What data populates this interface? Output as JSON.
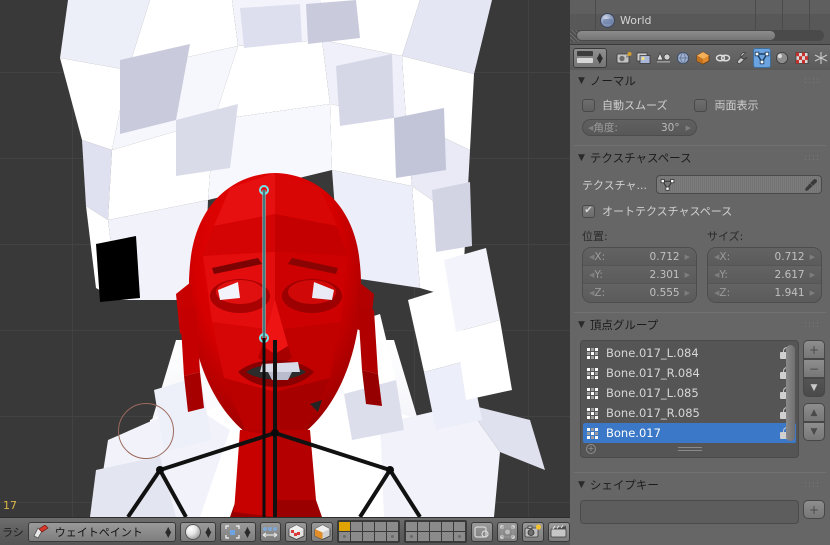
{
  "app": "Blender",
  "viewport": {
    "frame_number": "17",
    "brush_cursor": "circle",
    "mesh_description": "low-poly character head, weight-painted red",
    "background_color": "#393939",
    "weight_color": "#d00000",
    "grid_color": "#424242"
  },
  "bottom_header": {
    "truncated_label": "ラシ",
    "mode_label": "ウェイトペイント",
    "mode_icon": "weight-paint-brush-icon",
    "shading_icon": "solid-shading-sphere-icon",
    "pivot_icon": "pivot-median-point-icon",
    "manipulator_icon": "transform-manipulator-icon",
    "texture_paint_icon": "texture-solid-cube-icon",
    "occlude_icon": "occlude-geometry-cube-icon",
    "layers_label": "scene-layers",
    "proportional_icon": "proportional-edit-icon",
    "snap_icon": "snap-magnet-icon",
    "render_icon": "render-camera-icon",
    "animation_icon": "render-animation-clapper-icon"
  },
  "outliner": {
    "item_label": "World",
    "item_icon": "world-globe-icon",
    "scrollbar": "horizontal-scrollbar"
  },
  "properties_header": {
    "editor_type_icon": "editor-type-properties-icon",
    "tabs": [
      {
        "name": "render-tab",
        "icon": "camera-back-icon",
        "active": false
      },
      {
        "name": "render-layers-tab",
        "icon": "images-icon",
        "active": false
      },
      {
        "name": "scene-tab",
        "icon": "scene-cone-sphere-icon",
        "active": false
      },
      {
        "name": "world-tab",
        "icon": "world-globe-icon",
        "active": false
      },
      {
        "name": "object-tab",
        "icon": "orange-cube-icon",
        "active": false
      },
      {
        "name": "constraints-tab",
        "icon": "chain-link-icon",
        "active": false
      },
      {
        "name": "modifiers-tab",
        "icon": "wrench-icon",
        "active": false
      },
      {
        "name": "object-data-tab",
        "icon": "green-triangle-mesh-data-icon",
        "active": true
      },
      {
        "name": "material-tab",
        "icon": "material-sphere-icon",
        "active": false
      },
      {
        "name": "texture-tab",
        "icon": "checker-texture-icon",
        "active": false
      },
      {
        "name": "particles-tab",
        "icon": "particles-icon",
        "active": false
      }
    ]
  },
  "panels": {
    "normals": {
      "title": "ノーマル",
      "auto_smooth": {
        "label": "自動スムーズ",
        "checked": false
      },
      "double_sided": {
        "label": "両面表示",
        "checked": false
      },
      "angle": {
        "label": "角度:",
        "value": "30°"
      }
    },
    "texture_space": {
      "title": "テクスチャスペース",
      "texture_mesh": {
        "label": "テクスチャ...",
        "value": "",
        "icon": "mesh-data-icon",
        "eyedropper": "eyedropper-icon"
      },
      "auto_texture_space": {
        "label": "オートテクスチャスペース",
        "checked": true
      },
      "location": {
        "label": "位置:",
        "axes": [
          {
            "k": "X:",
            "v": "0.712"
          },
          {
            "k": "Y:",
            "v": "2.301"
          },
          {
            "k": "Z:",
            "v": "0.555"
          }
        ]
      },
      "size": {
        "label": "サイズ:",
        "axes": [
          {
            "k": "X:",
            "v": "0.712"
          },
          {
            "k": "Y:",
            "v": "2.617"
          },
          {
            "k": "Z:",
            "v": "1.941"
          }
        ]
      }
    },
    "vertex_groups": {
      "title": "頂点グループ",
      "items": [
        {
          "label": "Bone.017_L.084",
          "selected": false,
          "locked": false
        },
        {
          "label": "Bone.017_R.084",
          "selected": false,
          "locked": false
        },
        {
          "label": "Bone.017_L.085",
          "selected": false,
          "locked": false
        },
        {
          "label": "Bone.017_R.085",
          "selected": false,
          "locked": false
        },
        {
          "label": "Bone.017",
          "selected": true,
          "locked": false
        }
      ],
      "buttons": {
        "add": "+",
        "remove": "−",
        "specials": "▼",
        "move_up": "▲",
        "move_down": "▼"
      },
      "selection_accent": "#3c78c8"
    },
    "shape_keys": {
      "title": "シェイプキー",
      "add_button": "+"
    }
  }
}
